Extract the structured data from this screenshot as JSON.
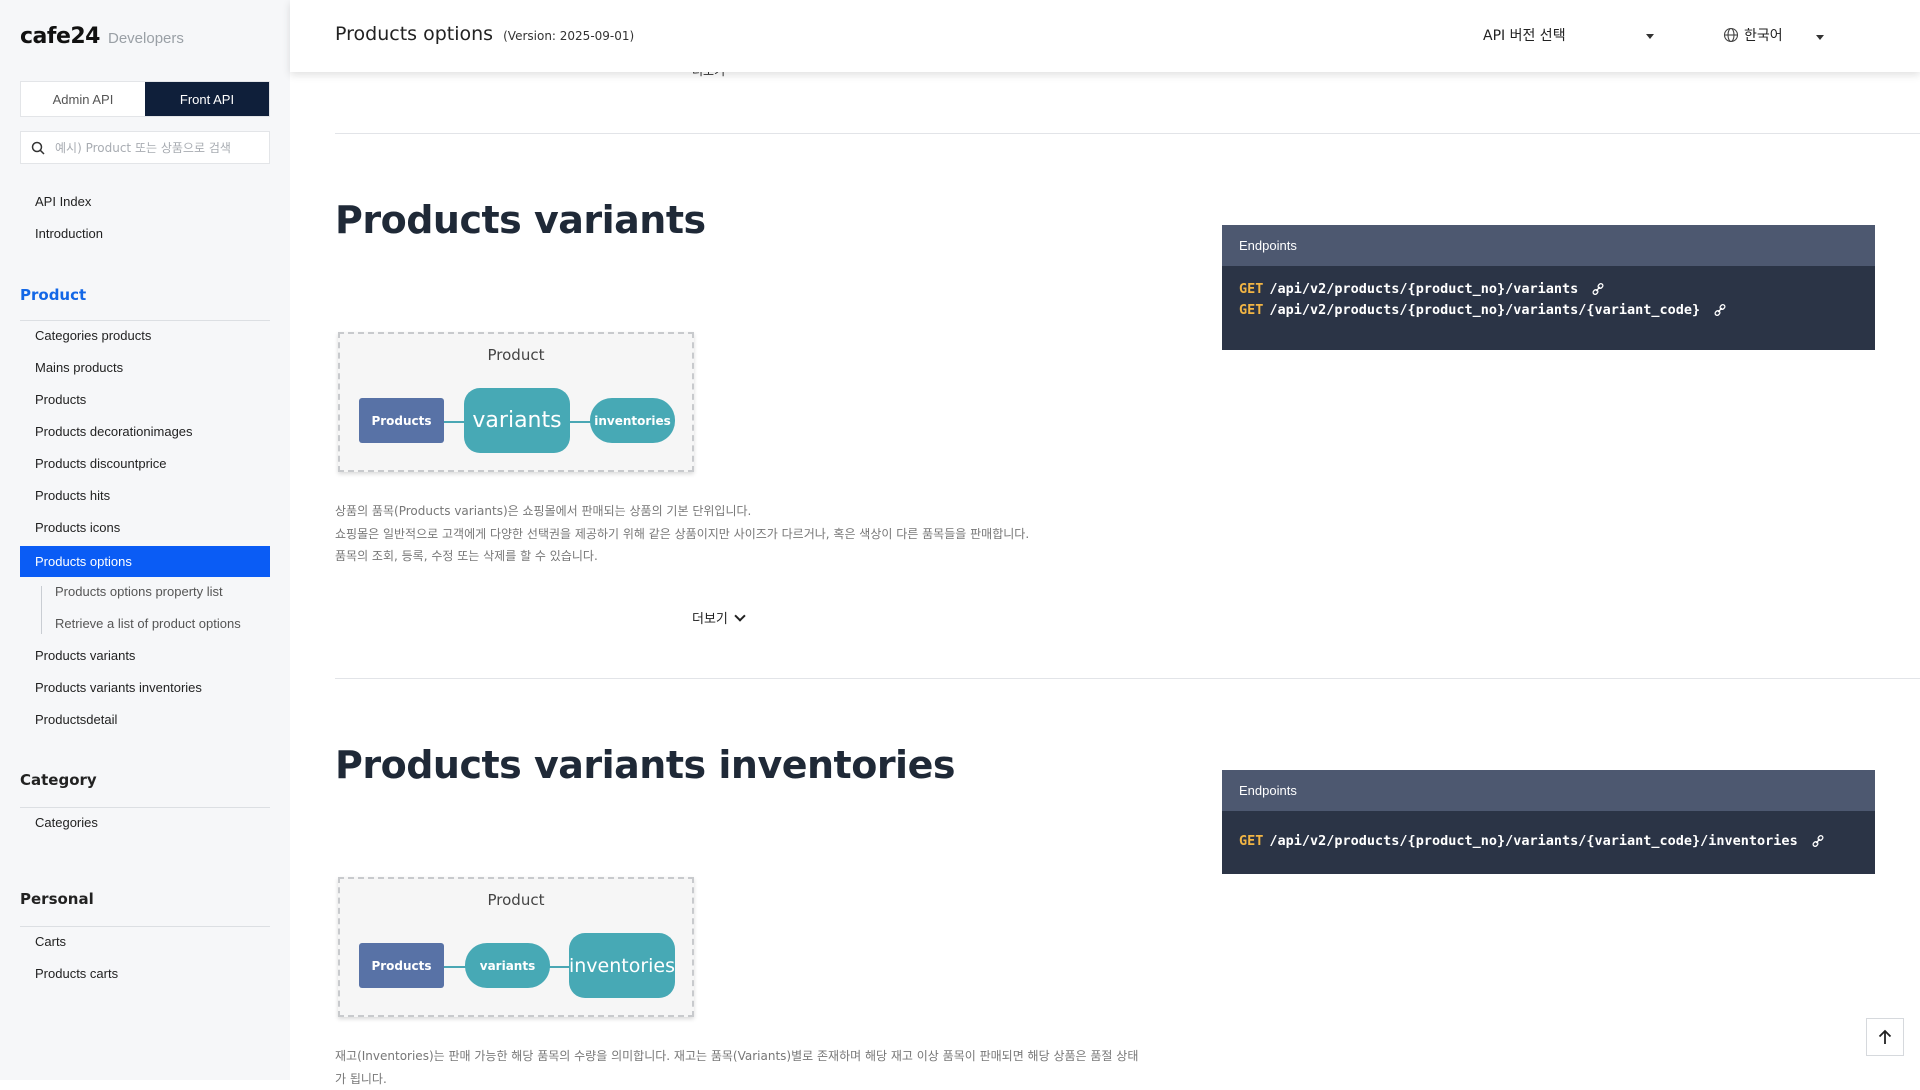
{
  "sidebar": {
    "logo": {
      "mark": "cafe24",
      "sub": "Developers"
    },
    "api_tabs": {
      "admin": "Admin API",
      "front": "Front API"
    },
    "search": {
      "placeholder": "예시) Product 또는 상품으로 검색"
    },
    "top_links": [
      "API Index",
      "Introduction"
    ],
    "sections": [
      {
        "title": "Product",
        "items": [
          "Categories products",
          "Mains products",
          "Products",
          "Products decorationimages",
          "Products discountprice",
          "Products hits",
          "Products icons",
          "Products options",
          "Products variants",
          "Products variants inventories",
          "Productsdetail"
        ],
        "sub_items": [
          "Products options property list",
          "Retrieve a list of product options"
        ]
      },
      {
        "title": "Category",
        "items": [
          "Categories"
        ]
      },
      {
        "title": "Personal",
        "items": [
          "Carts",
          "Products carts"
        ]
      }
    ]
  },
  "header": {
    "title": "Products options",
    "version": "(Version: 2025-09-01)",
    "version_select": "API 버전 선택",
    "language": "한국어"
  },
  "content": {
    "cut_more": "더보기",
    "variants": {
      "heading": "Products variants",
      "diagram": {
        "title": "Product",
        "products": "Products",
        "variants": "variants",
        "inventories": "inventories"
      },
      "desc": [
        "상품의 품목(Products variants)은 쇼핑몰에서 판매되는 상품의 기본 단위입니다.",
        "쇼핑몰은 일반적으로 고객에게 다양한 선택권을 제공하기 위해 같은 상품이지만 사이즈가 다르거나, 혹은 색상이 다른 품목들을 판매합니다.",
        "품목의 조회, 등록, 수정 또는 삭제를 할 수 있습니다."
      ],
      "more": "더보기",
      "endpoints_title": "Endpoints",
      "endpoints": [
        {
          "method": "GET",
          "path": "/api/v2/products/{product_no}/variants"
        },
        {
          "method": "GET",
          "path": "/api/v2/products/{product_no}/variants/{variant_code}"
        }
      ]
    },
    "inventories": {
      "heading": "Products variants inventories",
      "diagram": {
        "title": "Product",
        "products": "Products",
        "variants": "variants",
        "inventories": "inventories"
      },
      "desc": [
        "재고(Inventories)는 판매 가능한 해당 품목의 수량을 의미합니다. 재고는 품목(Variants)별로 존재하며 해당 재고 이상 품목이 판매되면 해당 상품은 품절 상태",
        "가 됩니다."
      ],
      "endpoints_title": "Endpoints",
      "endpoints": [
        {
          "method": "GET",
          "path": "/api/v2/products/{product_no}/variants/{variant_code}/inventories"
        }
      ]
    }
  },
  "colors": {
    "accent": "#0a5cf5",
    "front_tab": "#0f1f3a",
    "endpoint_bg": "#2b3446",
    "endpoint_head": "#4d5870",
    "method": "#f2b544",
    "diagram_teal": "#47a9b5",
    "diagram_blue": "#5872a6"
  },
  "icons": {
    "search": "search-icon",
    "globe": "globe-icon",
    "link": "link-icon",
    "scroll_top": "arrow-up-icon"
  }
}
